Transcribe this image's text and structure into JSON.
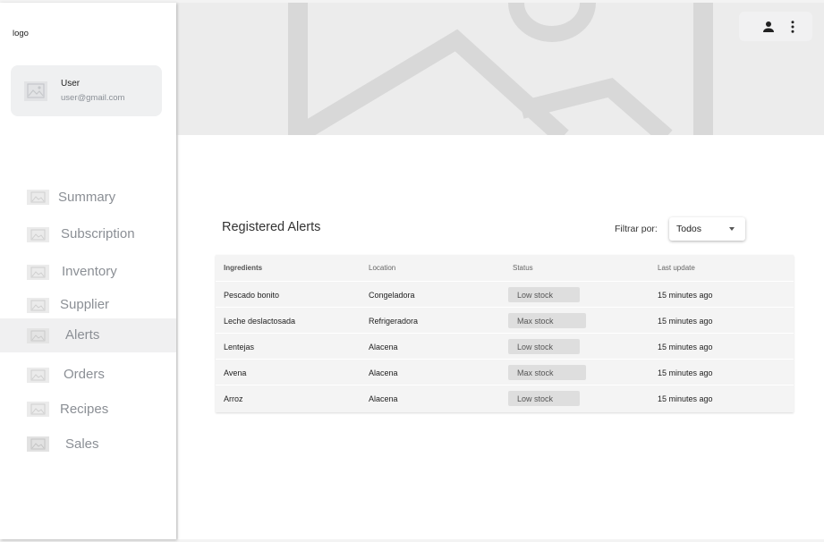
{
  "app": {
    "logo": "logo"
  },
  "user": {
    "name": "User",
    "email": "user@gmail.com"
  },
  "sidebar": {
    "items": [
      {
        "label": "Summary",
        "active": false
      },
      {
        "label": "Subscription",
        "active": false
      },
      {
        "label": "Inventory",
        "active": false
      },
      {
        "label": "Supplier",
        "active": false
      },
      {
        "label": "Alerts",
        "active": true
      },
      {
        "label": "Orders",
        "active": false
      },
      {
        "label": "Recipes",
        "active": false
      },
      {
        "label": "Sales",
        "active": false
      }
    ]
  },
  "alerts": {
    "title": "Registered Alerts",
    "filter": {
      "label": "Filtrar por:",
      "value": "Todos"
    },
    "columns": [
      "Ingredients",
      "Location",
      "Status",
      "Last update"
    ],
    "rows": [
      {
        "ingredient": "Pescado bonito",
        "location": "Congeladora",
        "status": "Low stock",
        "updated": "15 minutes ago"
      },
      {
        "ingredient": "Leche deslactosada",
        "location": "Refrigeradora",
        "status": "Max stock",
        "updated": "15 minutes ago"
      },
      {
        "ingredient": "Lentejas",
        "location": "Alacena",
        "status": "Low stock",
        "updated": "15 minutes ago"
      },
      {
        "ingredient": "Avena",
        "location": "Alacena",
        "status": "Max stock",
        "updated": "15 minutes ago"
      },
      {
        "ingredient": "Arroz",
        "location": "Alacena",
        "status": "Low stock",
        "updated": "15 minutes ago"
      }
    ]
  },
  "icons": {
    "banner": "image-placeholder-icon",
    "account": "person-icon",
    "menu": "more-vert-icon",
    "nav": "image-placeholder-icon"
  },
  "colors": {
    "sidebar_bg": "#ffffff",
    "banner_bg": "#ececec",
    "active_nav_bg": "#f0f0f1",
    "chip_bg": "#dedede",
    "table_bg": "#f4f4f4"
  }
}
